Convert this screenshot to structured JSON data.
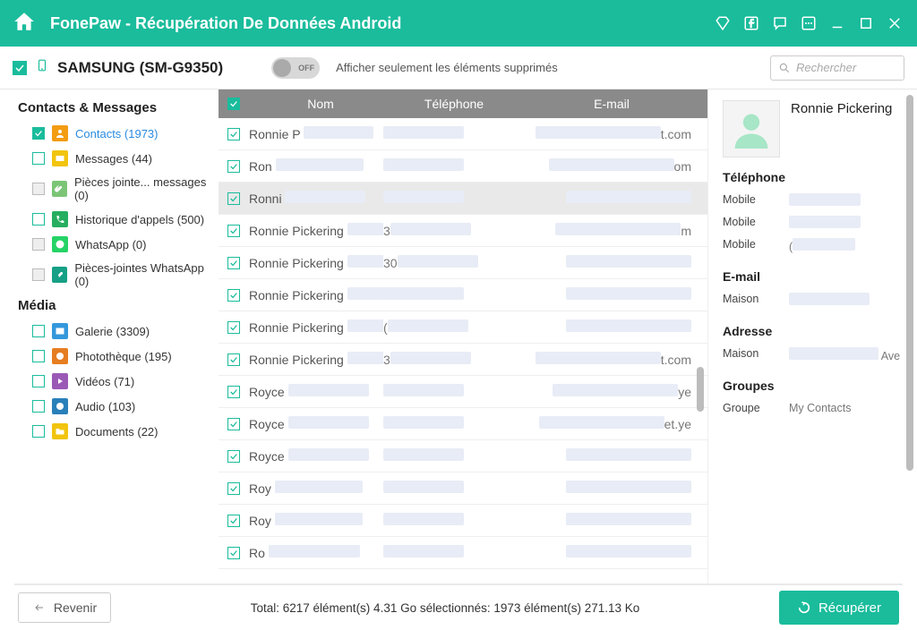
{
  "app": {
    "title": "FonePaw - Récupération De Données Android"
  },
  "toolbar": {
    "device": "SAMSUNG (SM-G9350)",
    "toggle_label": "OFF",
    "filter_text": "Afficher seulement les éléments supprimés",
    "search_placeholder": "Rechercher"
  },
  "sidebar": {
    "section_contacts": "Contacts & Messages",
    "section_media": "Média",
    "items": [
      {
        "label": "Contacts (1973)"
      },
      {
        "label": "Messages (44)"
      },
      {
        "label": "Pièces jointe... messages (0)"
      },
      {
        "label": "Historique d'appels (500)"
      },
      {
        "label": "WhatsApp (0)"
      },
      {
        "label": "Pièces-jointes WhatsApp (0)"
      },
      {
        "label": "Galerie (3309)"
      },
      {
        "label": "Photothèque (195)"
      },
      {
        "label": "Vidéos (71)"
      },
      {
        "label": "Audio (103)"
      },
      {
        "label": "Documents (22)"
      }
    ]
  },
  "table": {
    "headers": {
      "name": "Nom",
      "phone": "Téléphone",
      "email": "E-mail"
    },
    "rows": [
      {
        "name": "Ronnie P",
        "email_suffix": "t.com"
      },
      {
        "name": "Ron",
        "email_suffix": "om"
      },
      {
        "name": "Ronni",
        "email_suffix": ""
      },
      {
        "name": "Ronnie Pickering",
        "phone_prefix": "3",
        "email_suffix": "m"
      },
      {
        "name": "Ronnie Pickering",
        "phone_prefix": "30",
        "email_suffix": ""
      },
      {
        "name": "Ronnie Pickering",
        "email_suffix": ""
      },
      {
        "name": "Ronnie Pickering",
        "phone_prefix": "(",
        "email_suffix": ""
      },
      {
        "name": "Ronnie Pickering",
        "phone_prefix": "3",
        "email_suffix": "t.com"
      },
      {
        "name": "Royce",
        "email_suffix": "ye"
      },
      {
        "name": "Royce",
        "email_suffix": "et.ye"
      },
      {
        "name": "Royce",
        "email_suffix": ""
      },
      {
        "name": "Roy",
        "email_suffix": ""
      },
      {
        "name": "Roy",
        "email_suffix": ""
      },
      {
        "name": "Ro",
        "email_suffix": ""
      }
    ]
  },
  "detail": {
    "name": "Ronnie Pickering",
    "phone_title": "Téléphone",
    "phone_rows": [
      {
        "label": "Mobile",
        "value": ""
      },
      {
        "label": "Mobile",
        "value": ""
      },
      {
        "label": "Mobile",
        "value": "("
      }
    ],
    "email_title": "E-mail",
    "email_rows": [
      {
        "label": "Maison",
        "value": ""
      }
    ],
    "address_title": "Adresse",
    "address_rows": [
      {
        "label": "Maison",
        "value": "Ave"
      }
    ],
    "group_title": "Groupes",
    "group_rows": [
      {
        "label": "Groupe",
        "value": "My Contacts"
      }
    ]
  },
  "footer": {
    "back": "Revenir",
    "status": "Total: 6217 élément(s) 4.31 Go    sélectionnés: 1973 élément(s) 271.13 Ko",
    "recover": "Récupérer"
  }
}
